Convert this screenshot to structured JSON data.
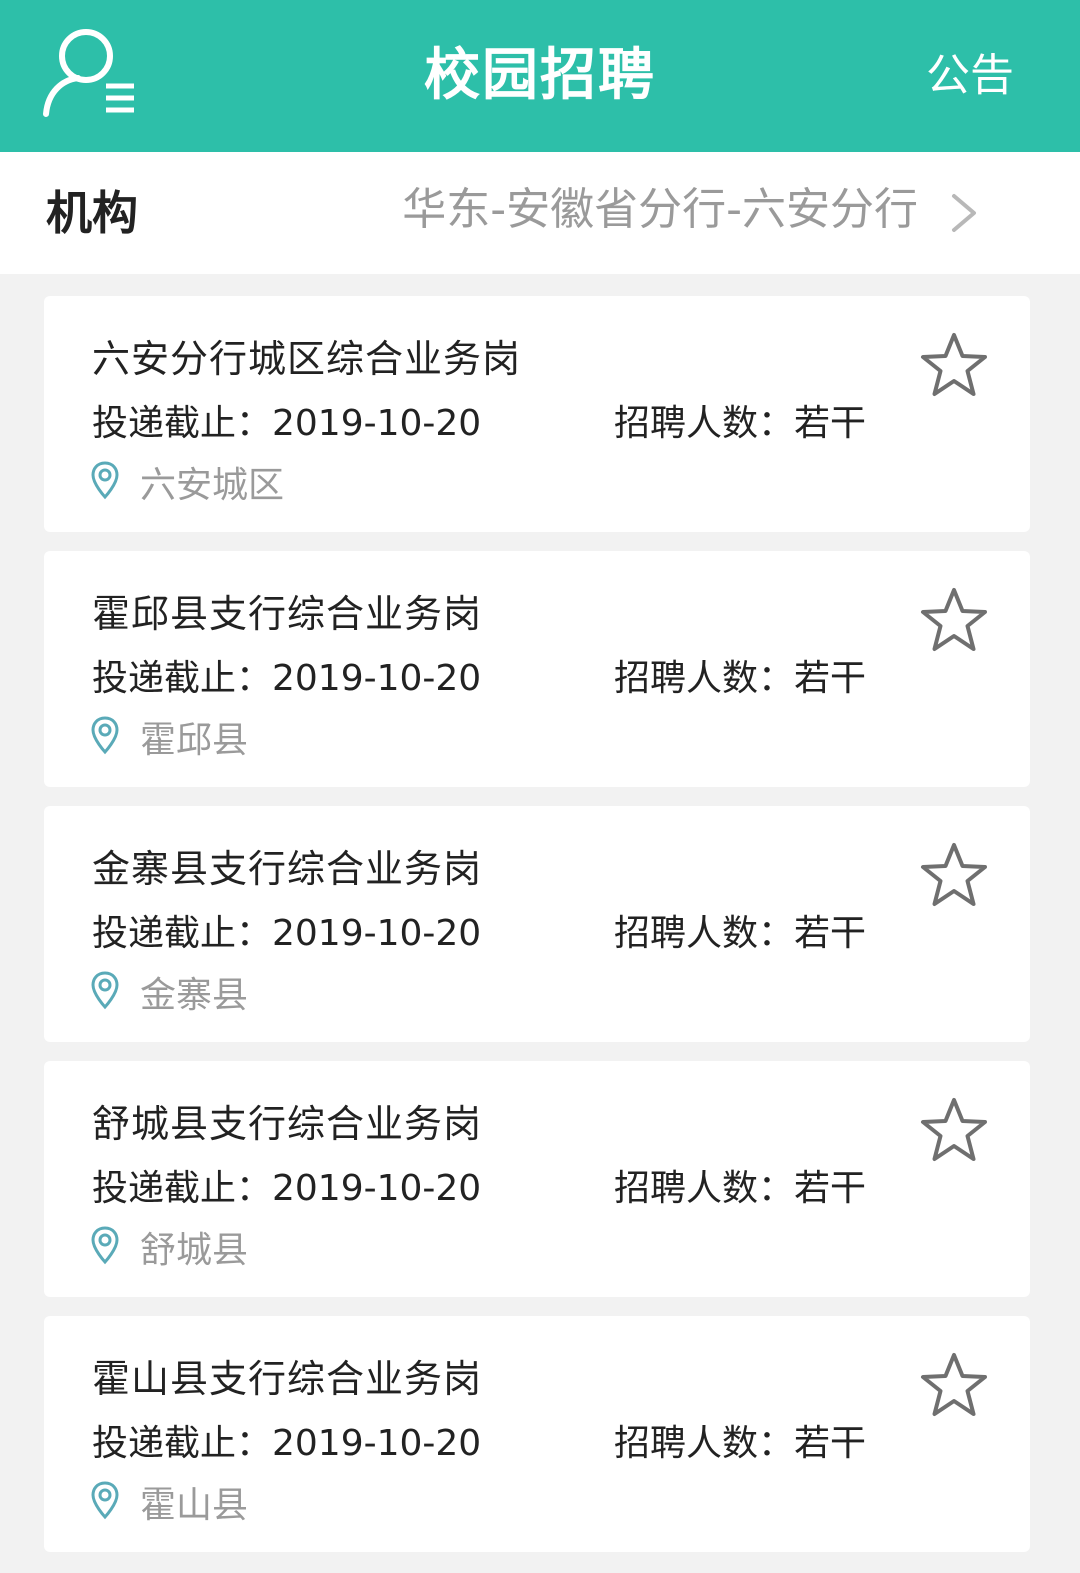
{
  "header": {
    "title": "校园招聘",
    "notice_label": "公告",
    "user_menu_icon": "user-menu-icon",
    "accent_color": "#2dbfa9"
  },
  "org": {
    "label": "机构",
    "value": "华东-安徽省分行-六安分行",
    "chevron_icon": "chevron-right-icon"
  },
  "jobs": [
    {
      "title": "六安分行城区综合业务岗",
      "deadline": "投递截止：2019-10-20",
      "headcount": "招聘人数：若干",
      "location": "六安城区"
    },
    {
      "title": "霍邱县支行综合业务岗",
      "deadline": "投递截止：2019-10-20",
      "headcount": "招聘人数：若干",
      "location": "霍邱县"
    },
    {
      "title": "金寨县支行综合业务岗",
      "deadline": "投递截止：2019-10-20",
      "headcount": "招聘人数：若干",
      "location": "金寨县"
    },
    {
      "title": "舒城县支行综合业务岗",
      "deadline": "投递截止：2019-10-20",
      "headcount": "招聘人数：若干",
      "location": "舒城县"
    },
    {
      "title": "霍山县支行综合业务岗",
      "deadline": "投递截止：2019-10-20",
      "headcount": "招聘人数：若干",
      "location": "霍山县"
    }
  ]
}
